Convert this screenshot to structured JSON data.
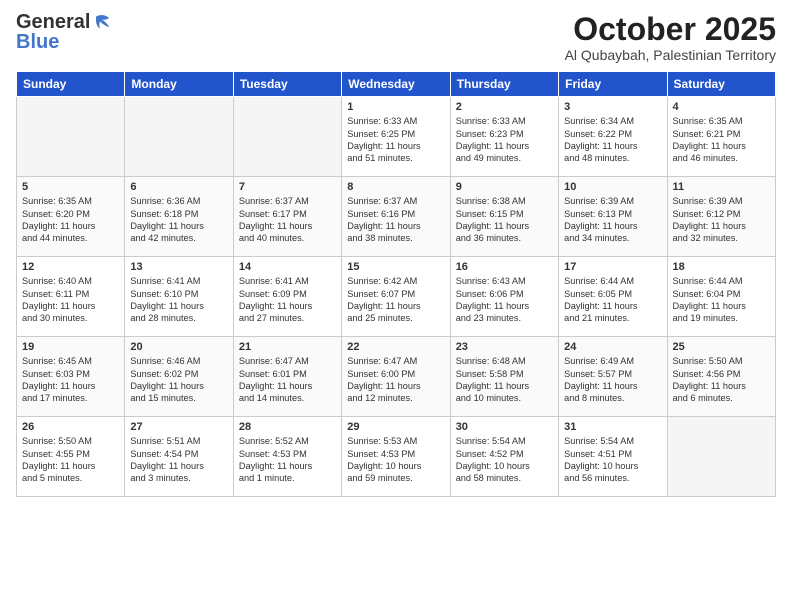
{
  "logo": {
    "general": "General",
    "blue": "Blue"
  },
  "header": {
    "month": "October 2025",
    "location": "Al Qubaybah, Palestinian Territory"
  },
  "weekdays": [
    "Sunday",
    "Monday",
    "Tuesday",
    "Wednesday",
    "Thursday",
    "Friday",
    "Saturday"
  ],
  "weeks": [
    [
      {
        "day": "",
        "content": ""
      },
      {
        "day": "",
        "content": ""
      },
      {
        "day": "",
        "content": ""
      },
      {
        "day": "1",
        "content": "Sunrise: 6:33 AM\nSunset: 6:25 PM\nDaylight: 11 hours\nand 51 minutes."
      },
      {
        "day": "2",
        "content": "Sunrise: 6:33 AM\nSunset: 6:23 PM\nDaylight: 11 hours\nand 49 minutes."
      },
      {
        "day": "3",
        "content": "Sunrise: 6:34 AM\nSunset: 6:22 PM\nDaylight: 11 hours\nand 48 minutes."
      },
      {
        "day": "4",
        "content": "Sunrise: 6:35 AM\nSunset: 6:21 PM\nDaylight: 11 hours\nand 46 minutes."
      }
    ],
    [
      {
        "day": "5",
        "content": "Sunrise: 6:35 AM\nSunset: 6:20 PM\nDaylight: 11 hours\nand 44 minutes."
      },
      {
        "day": "6",
        "content": "Sunrise: 6:36 AM\nSunset: 6:18 PM\nDaylight: 11 hours\nand 42 minutes."
      },
      {
        "day": "7",
        "content": "Sunrise: 6:37 AM\nSunset: 6:17 PM\nDaylight: 11 hours\nand 40 minutes."
      },
      {
        "day": "8",
        "content": "Sunrise: 6:37 AM\nSunset: 6:16 PM\nDaylight: 11 hours\nand 38 minutes."
      },
      {
        "day": "9",
        "content": "Sunrise: 6:38 AM\nSunset: 6:15 PM\nDaylight: 11 hours\nand 36 minutes."
      },
      {
        "day": "10",
        "content": "Sunrise: 6:39 AM\nSunset: 6:13 PM\nDaylight: 11 hours\nand 34 minutes."
      },
      {
        "day": "11",
        "content": "Sunrise: 6:39 AM\nSunset: 6:12 PM\nDaylight: 11 hours\nand 32 minutes."
      }
    ],
    [
      {
        "day": "12",
        "content": "Sunrise: 6:40 AM\nSunset: 6:11 PM\nDaylight: 11 hours\nand 30 minutes."
      },
      {
        "day": "13",
        "content": "Sunrise: 6:41 AM\nSunset: 6:10 PM\nDaylight: 11 hours\nand 28 minutes."
      },
      {
        "day": "14",
        "content": "Sunrise: 6:41 AM\nSunset: 6:09 PM\nDaylight: 11 hours\nand 27 minutes."
      },
      {
        "day": "15",
        "content": "Sunrise: 6:42 AM\nSunset: 6:07 PM\nDaylight: 11 hours\nand 25 minutes."
      },
      {
        "day": "16",
        "content": "Sunrise: 6:43 AM\nSunset: 6:06 PM\nDaylight: 11 hours\nand 23 minutes."
      },
      {
        "day": "17",
        "content": "Sunrise: 6:44 AM\nSunset: 6:05 PM\nDaylight: 11 hours\nand 21 minutes."
      },
      {
        "day": "18",
        "content": "Sunrise: 6:44 AM\nSunset: 6:04 PM\nDaylight: 11 hours\nand 19 minutes."
      }
    ],
    [
      {
        "day": "19",
        "content": "Sunrise: 6:45 AM\nSunset: 6:03 PM\nDaylight: 11 hours\nand 17 minutes."
      },
      {
        "day": "20",
        "content": "Sunrise: 6:46 AM\nSunset: 6:02 PM\nDaylight: 11 hours\nand 15 minutes."
      },
      {
        "day": "21",
        "content": "Sunrise: 6:47 AM\nSunset: 6:01 PM\nDaylight: 11 hours\nand 14 minutes."
      },
      {
        "day": "22",
        "content": "Sunrise: 6:47 AM\nSunset: 6:00 PM\nDaylight: 11 hours\nand 12 minutes."
      },
      {
        "day": "23",
        "content": "Sunrise: 6:48 AM\nSunset: 5:58 PM\nDaylight: 11 hours\nand 10 minutes."
      },
      {
        "day": "24",
        "content": "Sunrise: 6:49 AM\nSunset: 5:57 PM\nDaylight: 11 hours\nand 8 minutes."
      },
      {
        "day": "25",
        "content": "Sunrise: 5:50 AM\nSunset: 4:56 PM\nDaylight: 11 hours\nand 6 minutes."
      }
    ],
    [
      {
        "day": "26",
        "content": "Sunrise: 5:50 AM\nSunset: 4:55 PM\nDaylight: 11 hours\nand 5 minutes."
      },
      {
        "day": "27",
        "content": "Sunrise: 5:51 AM\nSunset: 4:54 PM\nDaylight: 11 hours\nand 3 minutes."
      },
      {
        "day": "28",
        "content": "Sunrise: 5:52 AM\nSunset: 4:53 PM\nDaylight: 11 hours\nand 1 minute."
      },
      {
        "day": "29",
        "content": "Sunrise: 5:53 AM\nSunset: 4:53 PM\nDaylight: 10 hours\nand 59 minutes."
      },
      {
        "day": "30",
        "content": "Sunrise: 5:54 AM\nSunset: 4:52 PM\nDaylight: 10 hours\nand 58 minutes."
      },
      {
        "day": "31",
        "content": "Sunrise: 5:54 AM\nSunset: 4:51 PM\nDaylight: 10 hours\nand 56 minutes."
      },
      {
        "day": "",
        "content": ""
      }
    ]
  ]
}
